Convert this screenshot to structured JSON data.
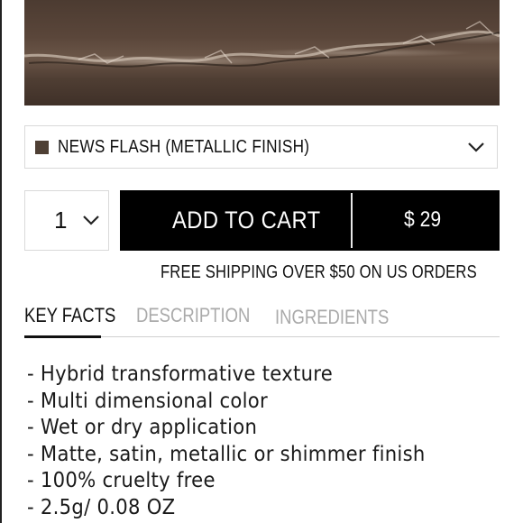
{
  "shade": {
    "name": "NEWS FLASH (METALLIC FINISH)",
    "chip_color": "#4e3f34",
    "dropdown_icon": "chevron-down-icon"
  },
  "quantity": {
    "value": "1",
    "dropdown_icon": "chevron-down-icon"
  },
  "cart": {
    "add_label": "ADD TO CART",
    "price": "$ 29",
    "background": "#000000"
  },
  "shipping_note": "FREE SHIPPING OVER $50 ON US ORDERS",
  "tabs": [
    {
      "label": "KEY FACTS",
      "active": true
    },
    {
      "label": "DESCRIPTION",
      "active": false
    },
    {
      "label": "INGREDIENTS",
      "active": false
    }
  ],
  "key_facts": [
    "- Hybrid transformative texture",
    "- Multi dimensional color",
    "- Wet or dry application",
    "- Matte, satin, metallic or shimmer finish",
    "- 100% cruelty free",
    "- 2.5g/ 0.08 OZ"
  ]
}
